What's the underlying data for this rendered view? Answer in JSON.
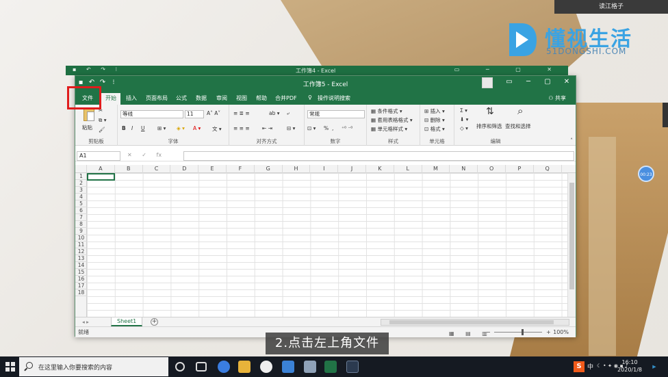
{
  "overlay": {
    "corner_tag": "读江格子",
    "logo_title": "懂视生活",
    "logo_sub": "51DONGSHI.COM",
    "float_bubble": "00:23",
    "caption": "2.点击左上角文件"
  },
  "back_window": {
    "title": "工作簿4 - Excel"
  },
  "excel": {
    "title": "工作簿5 - Excel",
    "tabs": [
      "文件",
      "开始",
      "插入",
      "页面布局",
      "公式",
      "数据",
      "审阅",
      "视图",
      "帮助",
      "合并PDF"
    ],
    "active_tab": "开始",
    "tell_me": "操作说明搜索",
    "share": "共享",
    "ribbon": {
      "clipboard": {
        "paste": "粘贴",
        "label": "剪贴板"
      },
      "font": {
        "name": "等线",
        "size": "11",
        "label": "字体",
        "bold": "B",
        "italic": "I",
        "underline": "U"
      },
      "alignment": {
        "label": "对齐方式"
      },
      "number": {
        "format": "常规",
        "label": "数字",
        "percent": "%"
      },
      "styles": {
        "cond": "条件格式",
        "table": "套用表格格式",
        "cell": "单元格样式",
        "label": "样式"
      },
      "cells": {
        "insert": "插入",
        "delete": "删除",
        "format": "格式",
        "label": "单元格"
      },
      "editing": {
        "sort": "排序和筛选",
        "find": "查找和选择",
        "label": "编辑"
      }
    },
    "name_box": "A1",
    "fx": "fx",
    "columns": [
      "A",
      "B",
      "C",
      "D",
      "E",
      "F",
      "G",
      "H",
      "I",
      "J",
      "K",
      "L",
      "M",
      "N",
      "O",
      "P",
      "Q"
    ],
    "rows": [
      "1",
      "2",
      "3",
      "4",
      "5",
      "6",
      "7",
      "8",
      "9",
      "10",
      "11",
      "12",
      "13",
      "14",
      "15",
      "16",
      "17",
      "18"
    ],
    "sheet_tab": "Sheet1",
    "status": "就绪",
    "zoom": "100%"
  },
  "taskbar": {
    "search_placeholder": "在这里输入你要搜索的内容",
    "ime": "S",
    "lang": "中",
    "time": "16:10",
    "date": "2020/1/8"
  },
  "colors": {
    "excel_green": "#217346",
    "highlight_red": "#e01c1c",
    "logo_blue": "#3aa3e3"
  }
}
